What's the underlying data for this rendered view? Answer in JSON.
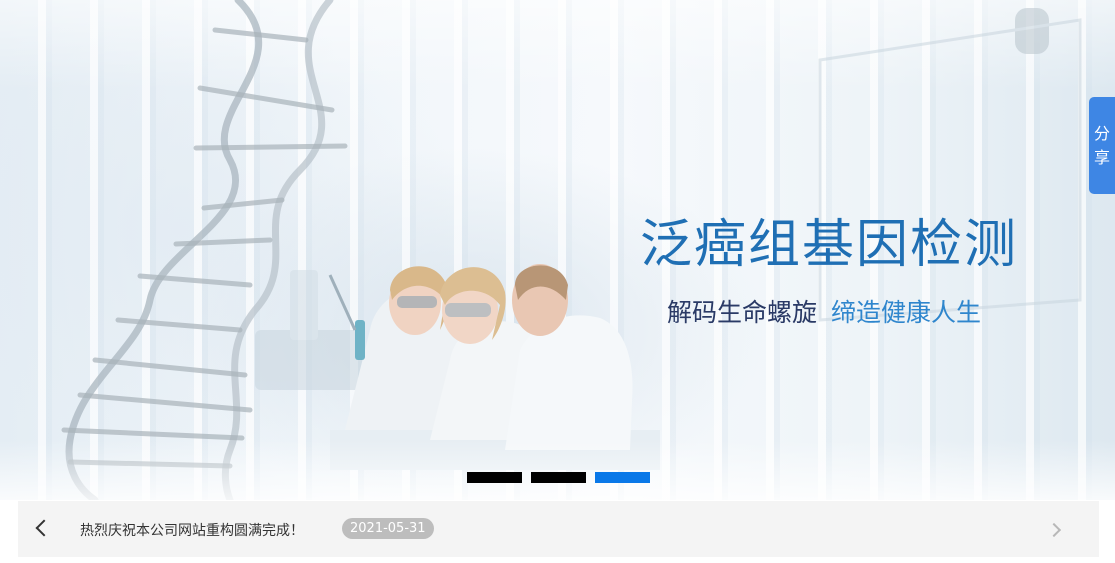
{
  "banner": {
    "headline": "泛癌组基因检测",
    "tagline_part1": "解码生命螺旋",
    "tagline_part2": "缔造健康人生",
    "slides_count": 3,
    "active_slide": 3,
    "colors": {
      "headline": "#1f6fb4",
      "tagline_dark": "#2a3a66",
      "tagline_blue": "#2f86cd",
      "dot_inactive": "#000000",
      "dot_active": "#0a78e8"
    }
  },
  "share": {
    "label_line1": "分",
    "label_line2": "享",
    "color": "#3e86e4"
  },
  "news": {
    "prev_icon": "chevron-left-icon",
    "next_icon": "chevron-right-icon",
    "title": "热烈庆祝本公司网站重构圆满完成！",
    "date": "2021-05-31"
  }
}
